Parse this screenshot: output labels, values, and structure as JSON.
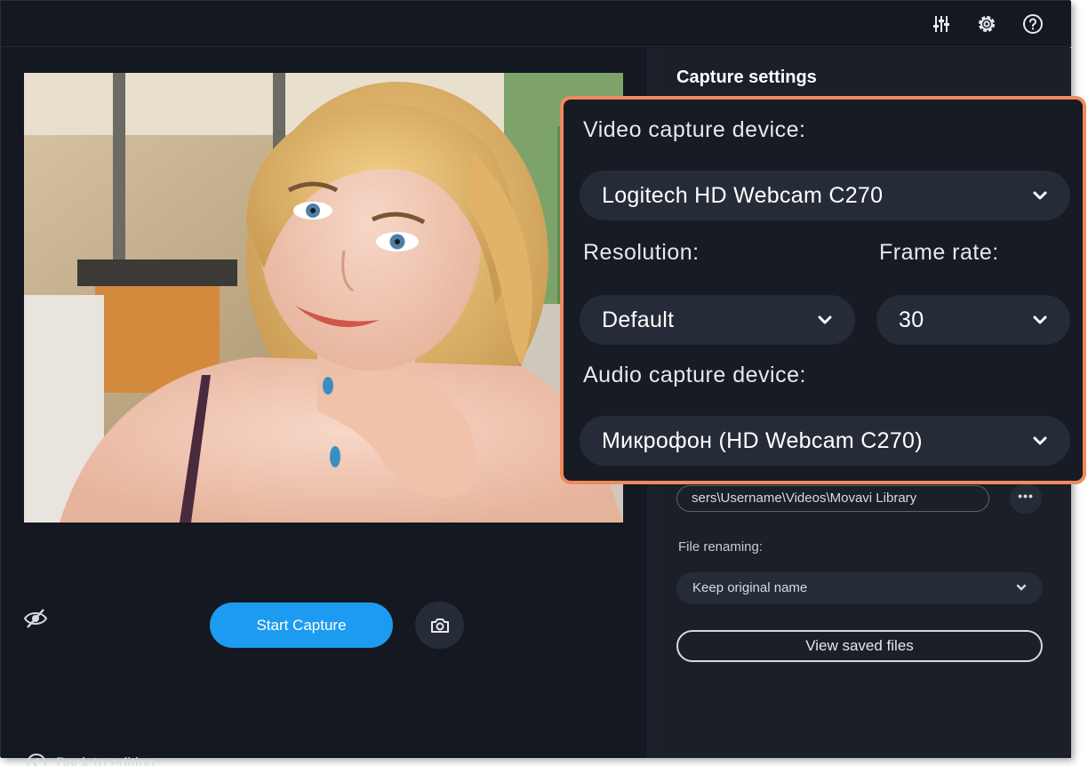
{
  "toolbar": {
    "icons": [
      "mixer-icon",
      "gear-icon",
      "help-icon"
    ]
  },
  "capture_settings": {
    "title": "Capture settings",
    "video_device_label": "Video capture device:",
    "video_device_value": "Logitech HD Webcam C270",
    "resolution_label": "Resolution:",
    "resolution_value": "Default",
    "frame_rate_label": "Frame rate:",
    "frame_rate_value": "30",
    "audio_device_label": "Audio capture device:",
    "audio_device_value": "Микрофон (HD Webcam C270)",
    "save_path_value": "sers\\Username\\Videos\\Movavi Library",
    "browse_label": "•••",
    "file_renaming_label": "File renaming:",
    "file_renaming_value": "Keep original name",
    "view_saved_label": "View saved files"
  },
  "controls": {
    "start_capture_label": "Start Capture",
    "back_label": "Back to editing"
  },
  "colors": {
    "accent": "#1d9bf0",
    "highlight": "#f08a5d",
    "background": "#141820"
  }
}
